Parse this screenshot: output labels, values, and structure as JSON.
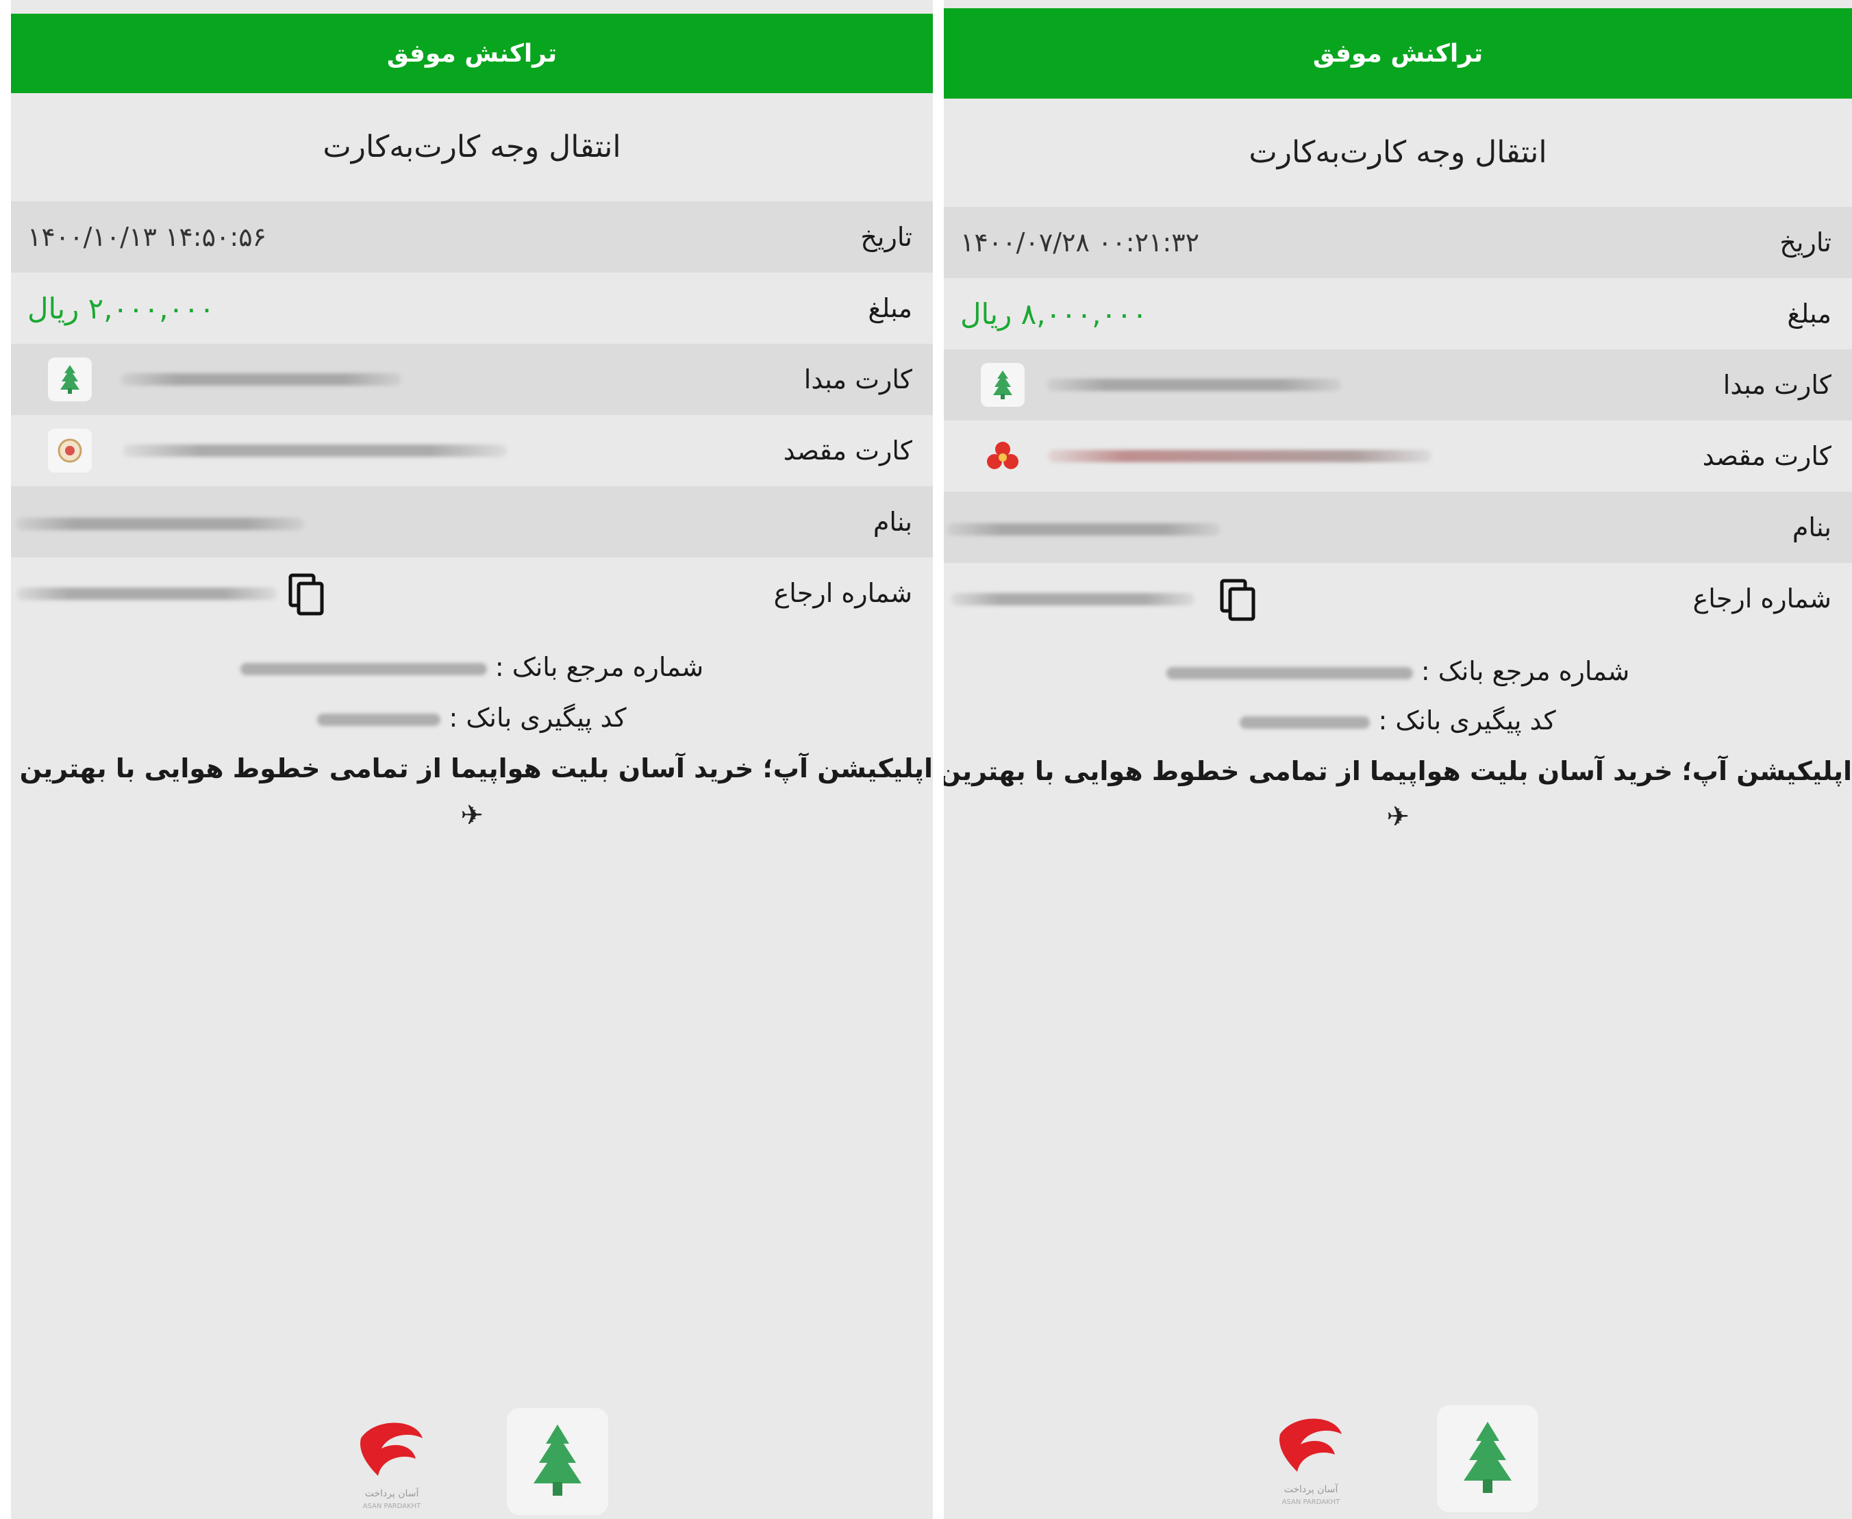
{
  "receipts": [
    {
      "header": "تراکنش موفق",
      "title": "انتقال وجه کارت‌به‌کارت",
      "rows": {
        "date": {
          "label": "تاریخ",
          "value": "۱۴۰۰/۱۰/۱۳ ۱۴:۵۰:۵۶"
        },
        "amount": {
          "label": "مبلغ",
          "value": "۲,۰۰۰,۰۰۰ ریال"
        },
        "source_card": {
          "label": "کارت مبدا"
        },
        "dest_card": {
          "label": "کارت مقصد"
        },
        "name": {
          "label": "بنام"
        },
        "reference": {
          "label": "شماره ارجاع"
        }
      },
      "bank_reference_label": "شماره مرجع بانک :",
      "bank_tracking_label": "کد پیگیری بانک :",
      "ad_text": "اپلیکیشن آپ؛ خرید آسان بلیت هواپیما از تمامی خطوط هوایی با بهترین قیمت",
      "plane_icon": "✈"
    },
    {
      "header": "تراکنش موفق",
      "title": "انتقال وجه کارت‌به‌کارت",
      "rows": {
        "date": {
          "label": "تاریخ",
          "value": "۱۴۰۰/۰۷/۲۸ ۰۰:۲۱:۳۲"
        },
        "amount": {
          "label": "مبلغ",
          "value": "۸,۰۰۰,۰۰۰ ریال"
        },
        "source_card": {
          "label": "کارت مبدا"
        },
        "dest_card": {
          "label": "کارت مقصد"
        },
        "name": {
          "label": "بنام"
        },
        "reference": {
          "label": "شماره ارجاع"
        }
      },
      "bank_reference_label": "شماره مرجع بانک :",
      "bank_tracking_label": "کد پیگیری بانک :",
      "ad_text": "اپلیکیشن آپ؛ خرید آسان بلیت هواپیما از تمامی خطوط هوایی با بهترین قیمت",
      "plane_icon": "✈"
    }
  ],
  "colors": {
    "header_green": "#08a51f",
    "amount_green": "#1aa832",
    "background": "#e9e9e9",
    "alt_row": "#dcdcdc"
  },
  "icons": {
    "source_bank": "bank-keshavarzi-icon",
    "dest_bank_left": "bank-melli-icon",
    "dest_bank_right": "bank-saderat-icon",
    "copy": "copy-icon",
    "footer_left": "asan-pardakht-logo",
    "footer_right": "bank-keshavarzi-logo"
  }
}
